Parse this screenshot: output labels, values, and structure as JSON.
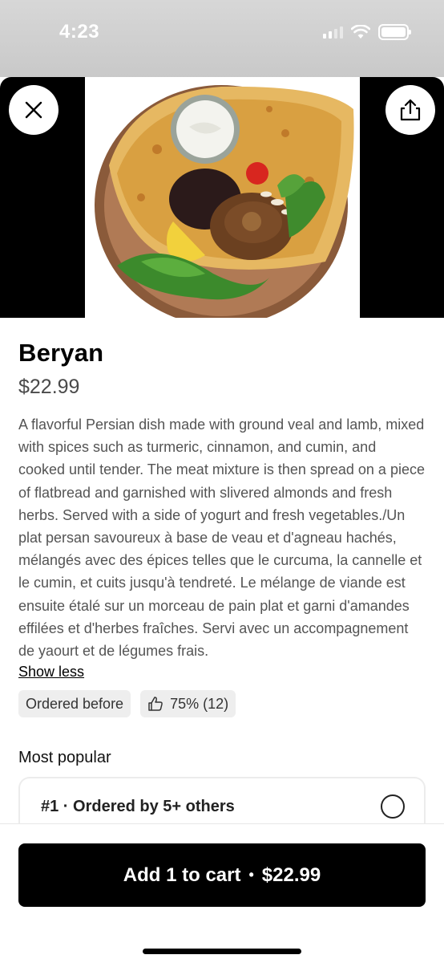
{
  "status_bar": {
    "time": "4:23"
  },
  "item": {
    "name": "Beryan",
    "price": "$22.99",
    "description": "A flavorful Persian dish made with ground veal and lamb, mixed with spices such as turmeric, cinnamon, and cumin, and cooked until tender. The meat mixture is then spread on a piece of flatbread and garnished with slivered almonds and fresh herbs. Served with a side of yogurt and fresh vegetables./Un plat persan savoureux à base de veau et d'agneau hachés, mélangés avec des épices telles que le curcuma, la cannelle et le cumin, et cuits jusqu'à tendreté. Le mélange de viande est ensuite étalé sur un morceau de pain plat et garni d'amandes effilées et d'herbes fraîches. Servi avec un accompagnement de yaourt et de légumes frais.",
    "show_less_label": "Show less"
  },
  "tags": {
    "ordered_before": "Ordered before",
    "rating": "75% (12)"
  },
  "most_popular": {
    "title": "Most popular",
    "first_option": "#1 · Ordered by 5+ others"
  },
  "cart": {
    "add_label": "Add 1 to cart",
    "separator": "•",
    "price": "$22.99"
  },
  "icons": {
    "close": "close-icon",
    "share": "share-icon",
    "thumbs_up": "thumbs-up-icon"
  }
}
